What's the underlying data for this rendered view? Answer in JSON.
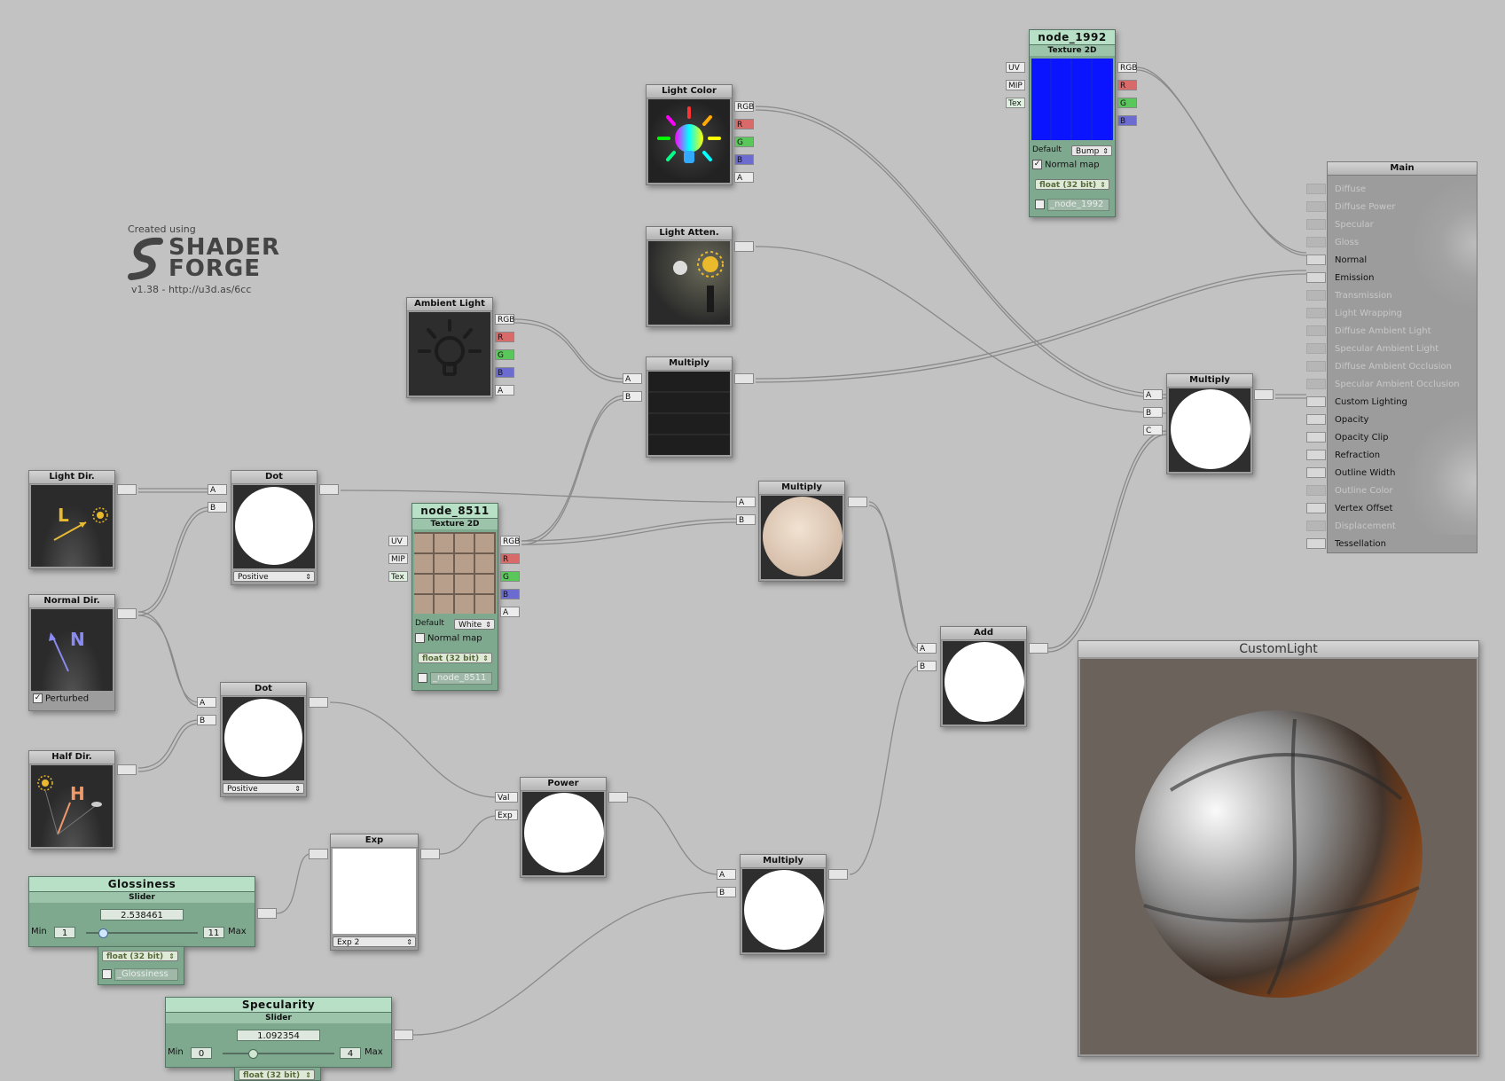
{
  "logo": {
    "created_using": "Created using",
    "name_line1": "SHADER",
    "name_line2": "FORGE",
    "version": "v1.38 - http://u3d.as/6cc"
  },
  "nodes": {
    "light_color": {
      "title": "Light Color",
      "ports": [
        "RGB",
        "R",
        "G",
        "B",
        "A"
      ]
    },
    "light_atten": {
      "title": "Light Atten."
    },
    "ambient_light": {
      "title": "Ambient Light",
      "ports": [
        "RGB",
        "R",
        "G",
        "B",
        "A"
      ]
    },
    "multiply_top": {
      "title": "Multiply",
      "inputs": [
        "A",
        "B"
      ]
    },
    "multiply_mid": {
      "title": "Multiply",
      "inputs": [
        "A",
        "B"
      ]
    },
    "multiply_right": {
      "title": "Multiply",
      "inputs": [
        "A",
        "B",
        "C"
      ]
    },
    "multiply_bottom": {
      "title": "Multiply",
      "inputs": [
        "A",
        "B"
      ]
    },
    "node_1992": {
      "title": "node_1992",
      "subtitle": "Texture 2D",
      "inputs": [
        "UV",
        "MIP",
        "Tex"
      ],
      "outputs": [
        "RGB",
        "R",
        "G",
        "B"
      ],
      "default_label": "Default",
      "default_value": "Bump",
      "normal_map_label": "Normal map",
      "normal_map_checked": true,
      "precision": "float (32 bit)",
      "prop_name": "_node_1992"
    },
    "node_8511": {
      "title": "node_8511",
      "subtitle": "Texture 2D",
      "inputs": [
        "UV",
        "MIP",
        "Tex"
      ],
      "outputs": [
        "RGB",
        "R",
        "G",
        "B",
        "A"
      ],
      "default_label": "Default",
      "default_value": "White",
      "normal_map_label": "Normal map",
      "normal_map_checked": false,
      "precision": "float (32 bit)",
      "prop_name": "_node_8511"
    },
    "light_dir": {
      "title": "Light Dir.",
      "glyph": "L"
    },
    "normal_dir": {
      "title": "Normal Dir.",
      "glyph": "N",
      "perturbed_label": "Perturbed",
      "perturbed_checked": true
    },
    "half_dir": {
      "title": "Half Dir.",
      "glyph": "H"
    },
    "dot_top": {
      "title": "Dot",
      "inputs": [
        "A",
        "B"
      ],
      "mode": "Positive"
    },
    "dot_bottom": {
      "title": "Dot",
      "inputs": [
        "A",
        "B"
      ],
      "mode": "Positive"
    },
    "add": {
      "title": "Add",
      "inputs": [
        "A",
        "B"
      ]
    },
    "power": {
      "title": "Power",
      "inputs": [
        "Val",
        "Exp"
      ]
    },
    "exp": {
      "title": "Exp",
      "mode": "Exp 2"
    },
    "glossiness": {
      "title": "Glossiness",
      "subtitle": "Slider",
      "value": "2.538461",
      "min_label": "Min",
      "min": "1",
      "max": "11",
      "max_label": "Max",
      "slider_fraction": 0.154,
      "precision": "float (32 bit)",
      "prop_name": "_Glossiness"
    },
    "specularity": {
      "title": "Specularity",
      "subtitle": "Slider",
      "value": "1.092354",
      "min_label": "Min",
      "min": "0",
      "max": "4",
      "max_label": "Max",
      "slider_fraction": 0.273,
      "precision": "float (32 bit)"
    }
  },
  "main": {
    "title": "Main",
    "items": [
      {
        "label": "Diffuse",
        "enabled": false
      },
      {
        "label": "Diffuse Power",
        "enabled": false
      },
      {
        "label": "Specular",
        "enabled": false
      },
      {
        "label": "Gloss",
        "enabled": false
      },
      {
        "label": "Normal",
        "enabled": true
      },
      {
        "label": "Emission",
        "enabled": true
      },
      {
        "label": "Transmission",
        "enabled": false
      },
      {
        "label": "Light Wrapping",
        "enabled": false
      },
      {
        "label": "Diffuse Ambient Light",
        "enabled": false
      },
      {
        "label": "Specular Ambient Light",
        "enabled": false
      },
      {
        "label": "Diffuse Ambient Occlusion",
        "enabled": false
      },
      {
        "label": "Specular Ambient Occlusion",
        "enabled": false
      },
      {
        "label": "Custom Lighting",
        "enabled": true
      },
      {
        "label": "Opacity",
        "enabled": true
      },
      {
        "label": "Opacity Clip",
        "enabled": true
      },
      {
        "label": "Refraction",
        "enabled": true
      },
      {
        "label": "Outline Width",
        "enabled": true
      },
      {
        "label": "Outline Color",
        "enabled": false
      },
      {
        "label": "Vertex Offset",
        "enabled": true
      },
      {
        "label": "Displacement",
        "enabled": false
      },
      {
        "label": "Tessellation",
        "enabled": true
      }
    ]
  },
  "preview": {
    "title": "CustomLight"
  },
  "colors": {
    "canvas": "#c2c2c2",
    "node_header": "#c8c8c8",
    "property_green": "#7fa98f",
    "wire": "#888888",
    "normal_map": "#0a14ff"
  }
}
